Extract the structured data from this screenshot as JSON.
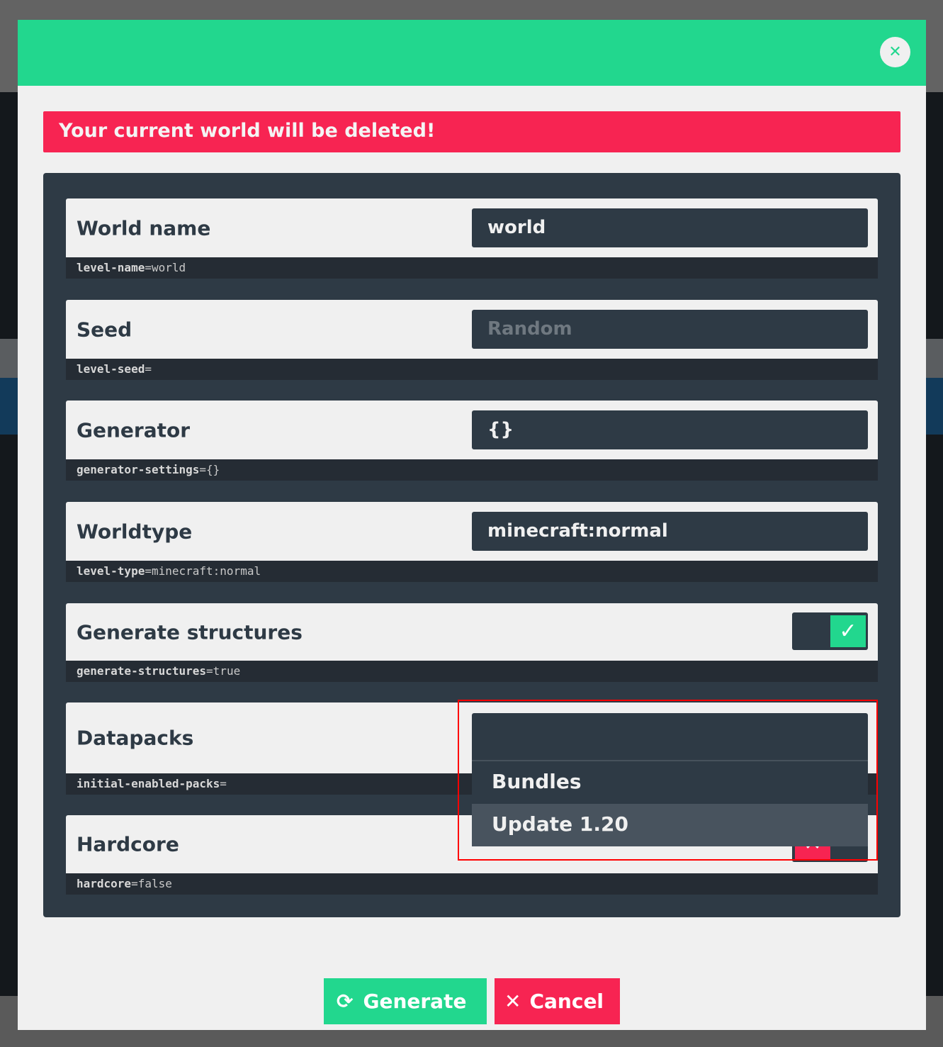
{
  "modal": {
    "close_icon": "close-icon",
    "alert": "Your current world will be deleted!"
  },
  "fields": [
    {
      "label": "World name",
      "value": "world",
      "placeholder": "",
      "code_key": "level-name",
      "code_value": "world"
    },
    {
      "label": "Seed",
      "value": "",
      "placeholder": "Random",
      "code_key": "level-seed",
      "code_value": ""
    },
    {
      "label": "Generator",
      "value": "{}",
      "placeholder": "",
      "code_key": "generator-settings",
      "code_value": "{}"
    },
    {
      "label": "Worldtype",
      "value": "minecraft:normal",
      "placeholder": "",
      "code_key": "level-type",
      "code_value": "minecraft:normal"
    },
    {
      "label": "Generate structures",
      "toggle": true,
      "code_key": "generate-structures",
      "code_value": "true"
    },
    {
      "label": "Datapacks",
      "code_key": "initial-enabled-packs",
      "code_value": ""
    },
    {
      "label": "Hardcore",
      "toggle": false,
      "code_key": "hardcore",
      "code_value": "false"
    }
  ],
  "datapacks_dropdown": {
    "selected": "",
    "options": [
      "Bundles",
      "Update 1.20"
    ],
    "highlighted": "Update 1.20"
  },
  "buttons": {
    "generate": "Generate",
    "cancel": "Cancel"
  },
  "colors": {
    "accent": "#22d78e",
    "danger": "#f72452",
    "panel": "#2e3a45"
  }
}
